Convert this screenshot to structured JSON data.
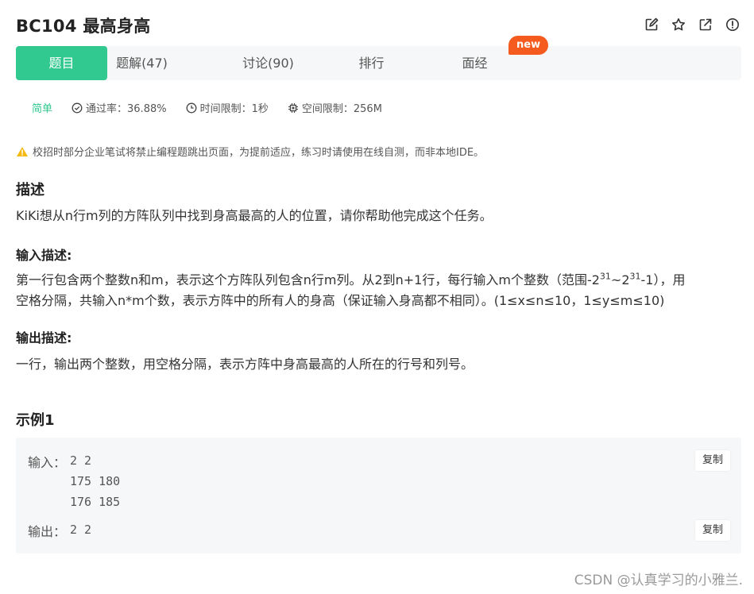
{
  "header": {
    "title": "BC104  最高身高",
    "icons": [
      "edit-icon",
      "star-icon",
      "share-icon",
      "report-icon"
    ]
  },
  "tabs": [
    {
      "label": "题目",
      "active": true
    },
    {
      "label": "题解(47)",
      "active": false
    },
    {
      "label": "讨论(90)",
      "active": false
    },
    {
      "label": "排行",
      "active": false
    },
    {
      "label": "面经",
      "active": false
    }
  ],
  "new_badge": "new",
  "meta": {
    "difficulty": "简单",
    "pass_rate": "通过率：36.88%",
    "time_limit": "时间限制：1秒",
    "space_limit": "空间限制：256M"
  },
  "notice": "校招时部分企业笔试将禁止编程题跳出页面，为提前适应，练习时请使用在线自测，而非本地IDE。",
  "description": {
    "title": "描述",
    "text": "KiKi想从n行m列的方阵队列中找到身高最高的人的位置，请你帮助他完成这个任务。"
  },
  "input_desc": {
    "title": "输入描述:",
    "line1_a": "第一行包含两个整数n和m，表示这个方阵队列包含n行m列。从2到n+1行，每行输入m个整数（范围-2",
    "sup1": "31",
    "line1_b": "~2",
    "sup2": "31",
    "line1_c": "-1），用",
    "line2": "空格分隔，共输入n*m个数，表示方阵中的所有人的身高（保证输入身高都不相同）。(1≤x≤n≤10，1≤y≤m≤10)"
  },
  "output_desc": {
    "title": "输出描述:",
    "text": "一行，输出两个整数，用空格分隔，表示方阵中身高最高的人所在的行号和列号。"
  },
  "example": {
    "title": "示例1",
    "input_label": "输入：",
    "input_lines": [
      "2 2",
      "175 180",
      "176 185"
    ],
    "output_label": "输出：",
    "output_line": "2 2",
    "copy_label": "复制"
  },
  "watermark": "CSDN @认真学习的小雅兰.",
  "colors": {
    "accent": "#32c990",
    "badge": "#f55a1f",
    "warning": "#f5b914"
  }
}
